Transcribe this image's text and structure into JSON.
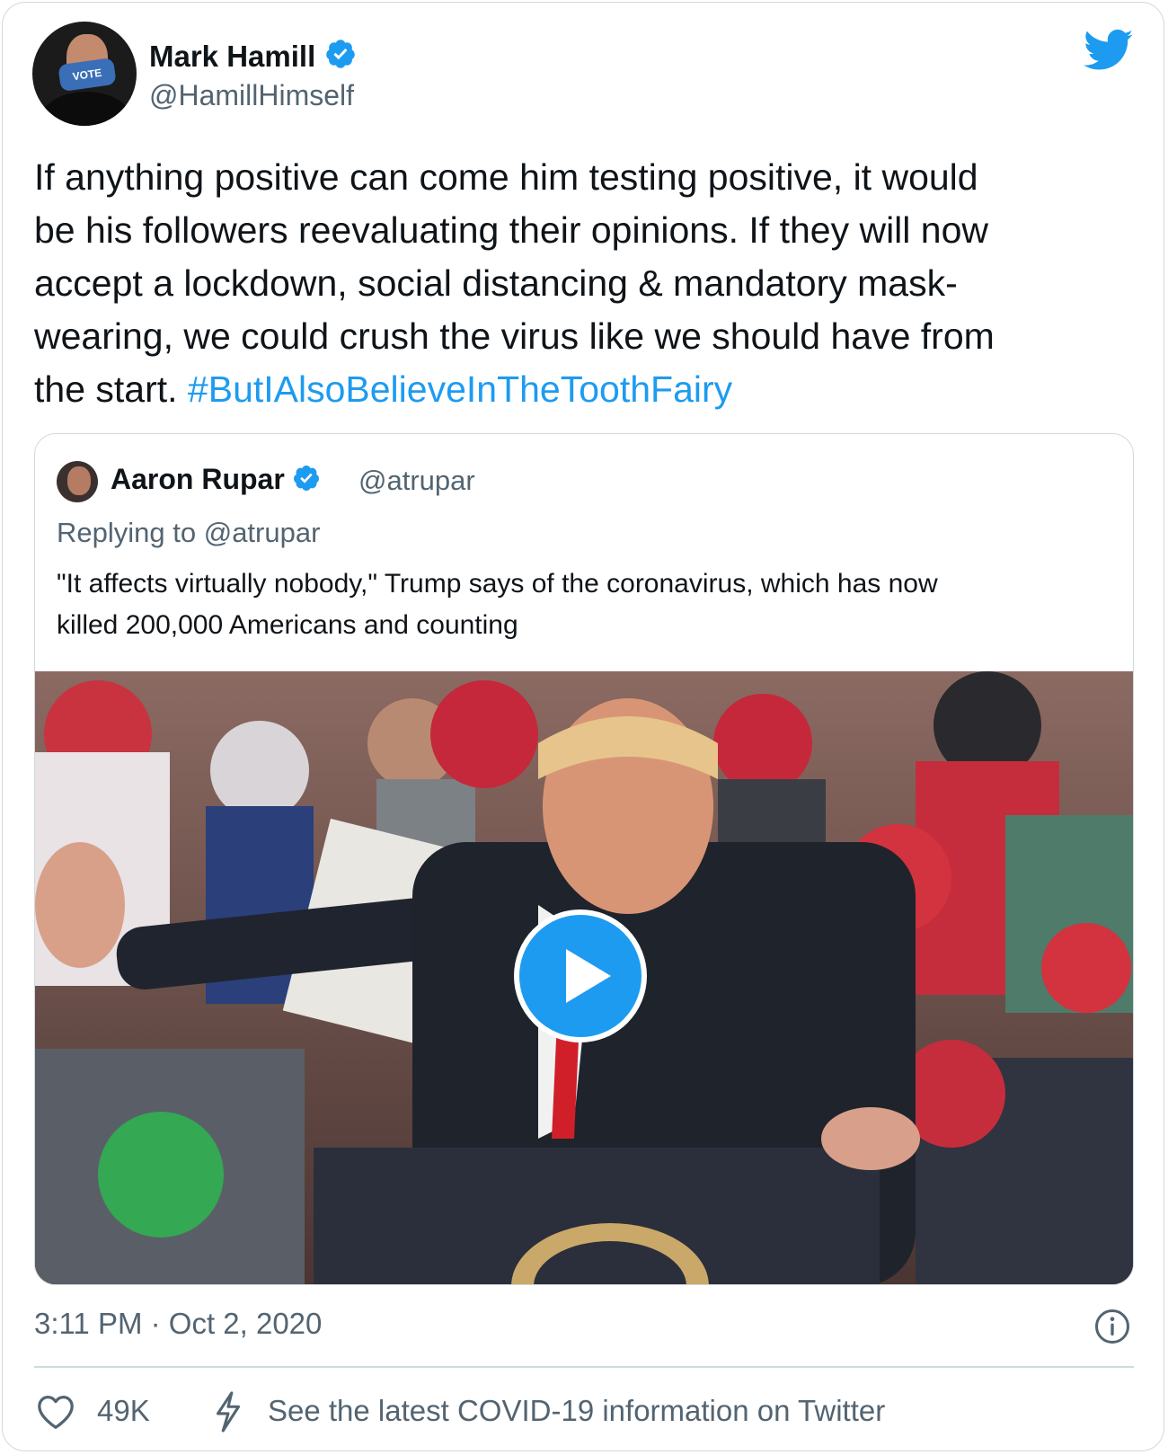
{
  "tweet": {
    "author_name": "Mark Hamill",
    "author_handle": "@HamillHimself",
    "avatar_mask_text": "VOTE",
    "text_lines": [
      "If anything positive can come him testing positive, it would",
      "be his followers reevaluating their opinions. If they will now",
      "accept a lockdown, social distancing & mandatory mask-",
      "wearing, we could crush the virus like we should have from"
    ],
    "text_last_line_prefix": "the start. ",
    "hashtag": "#ButIAlsoBelieveInTheToothFairy",
    "timestamp": "3:11 PM · Oct 2, 2020",
    "like_count": "49K",
    "covid_info": "See the latest COVID-19 information on Twitter"
  },
  "quoted_tweet": {
    "author_name": "Aaron Rupar",
    "author_handle": "@atrupar",
    "replying_prefix": "Replying to ",
    "replying_to": "@atrupar",
    "text_lines": [
      "\"It affects virtually nobody,\" Trump says of the coronavirus, which has now",
      "killed 200,000 Americans and counting"
    ]
  },
  "colors": {
    "accent": "#1d9bf0",
    "text": "#0f1419",
    "secondary": "#536471",
    "border": "#cfd9de"
  },
  "icons": [
    "twitter-bird-icon",
    "verified-badge-icon",
    "play-icon",
    "info-icon",
    "heart-icon",
    "lightning-icon"
  ]
}
